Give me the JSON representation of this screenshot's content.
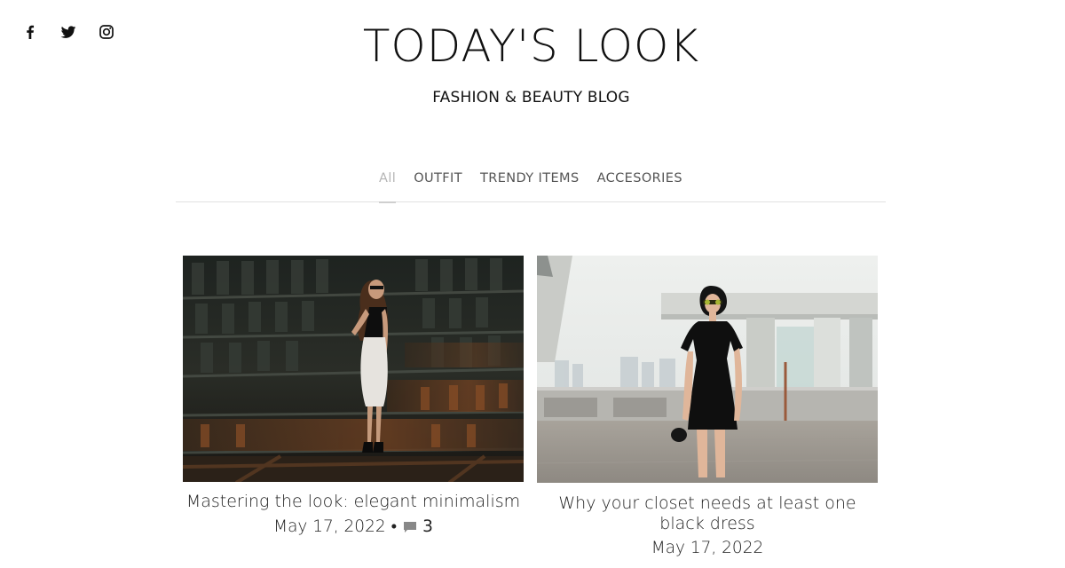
{
  "social": [
    {
      "name": "facebook-icon",
      "glyph": "f"
    },
    {
      "name": "twitter-icon"
    },
    {
      "name": "instagram-icon"
    }
  ],
  "site": {
    "title": "TODAY'S LOOK",
    "tagline": "FASHION & BEAUTY BLOG"
  },
  "nav": {
    "items": [
      {
        "label": "All",
        "active": true
      },
      {
        "label": "OUTFIT",
        "active": false
      },
      {
        "label": "TRENDY ITEMS",
        "active": false
      },
      {
        "label": "ACCESORIES",
        "active": false
      }
    ]
  },
  "posts": [
    {
      "title": "Mastering the look: elegant minimalism",
      "date": "May 17, 2022",
      "separator": "•",
      "comments": "3"
    },
    {
      "title": "Why your closet needs at least one black dress",
      "date": "May 17, 2022"
    }
  ],
  "colors": {
    "text": "#111111",
    "nav_inactive": "#555555",
    "nav_active": "#b5b5b5",
    "divider": "#e2e2e2",
    "comment_icon": "#888888"
  }
}
